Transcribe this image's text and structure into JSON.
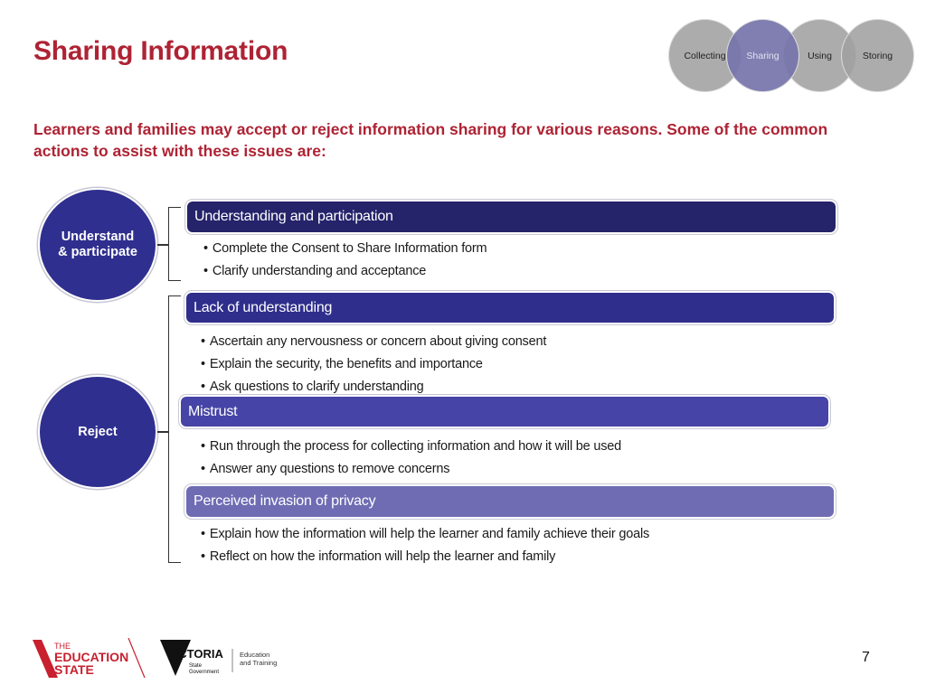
{
  "title": "Sharing Information",
  "stages": {
    "items": [
      "Collecting",
      "Sharing",
      "Using",
      "Storing"
    ],
    "active": "Sharing",
    "colors": {
      "inactive": "#a0a0a0",
      "active": "#7674aa"
    }
  },
  "intro": "Learners and families may accept or reject information sharing for various reasons. Some of the common actions to assist with these issues are:",
  "categories": [
    {
      "label": "Understand & participate",
      "line1": "Understand",
      "line2": "& participate"
    },
    {
      "label": "Reject"
    }
  ],
  "sections": [
    {
      "heading": "Understanding and participation",
      "color": "#25236a",
      "bullets": [
        "Complete the Consent to Share Information form",
        "Clarify understanding  and acceptance"
      ]
    },
    {
      "heading": "Lack of understanding",
      "color": "#2f2e8c",
      "bullets": [
        "Ascertain any nervousness or concern about giving  consent",
        "Explain  the security, the benefits and importance",
        "Ask questions to clarify understanding"
      ]
    },
    {
      "heading": "Mistrust",
      "color": "#4644a6",
      "bullets": [
        "Run through the process for collecting  information and how it will  be used",
        "Answer any questions to remove concerns"
      ]
    },
    {
      "heading": "Perceived invasion of privacy",
      "color": "#6f6cb4",
      "bullets": [
        "Explain  how the information will  help the learner and family achieve their goals",
        "Reflect on how the information will  help the learner and family"
      ]
    }
  ],
  "footer": {
    "logo_es": {
      "line1": "THE",
      "line2": "EDUCATION",
      "line3": "STATE"
    },
    "logo_vic": {
      "name": "VICTORIA",
      "sub1": "State",
      "sub2": "Government",
      "dept1": "Education",
      "dept2": "and Training"
    },
    "page_number": "7"
  },
  "colors": {
    "accent_red": "#ae2334",
    "circle_blue": "#2f2f8f"
  }
}
